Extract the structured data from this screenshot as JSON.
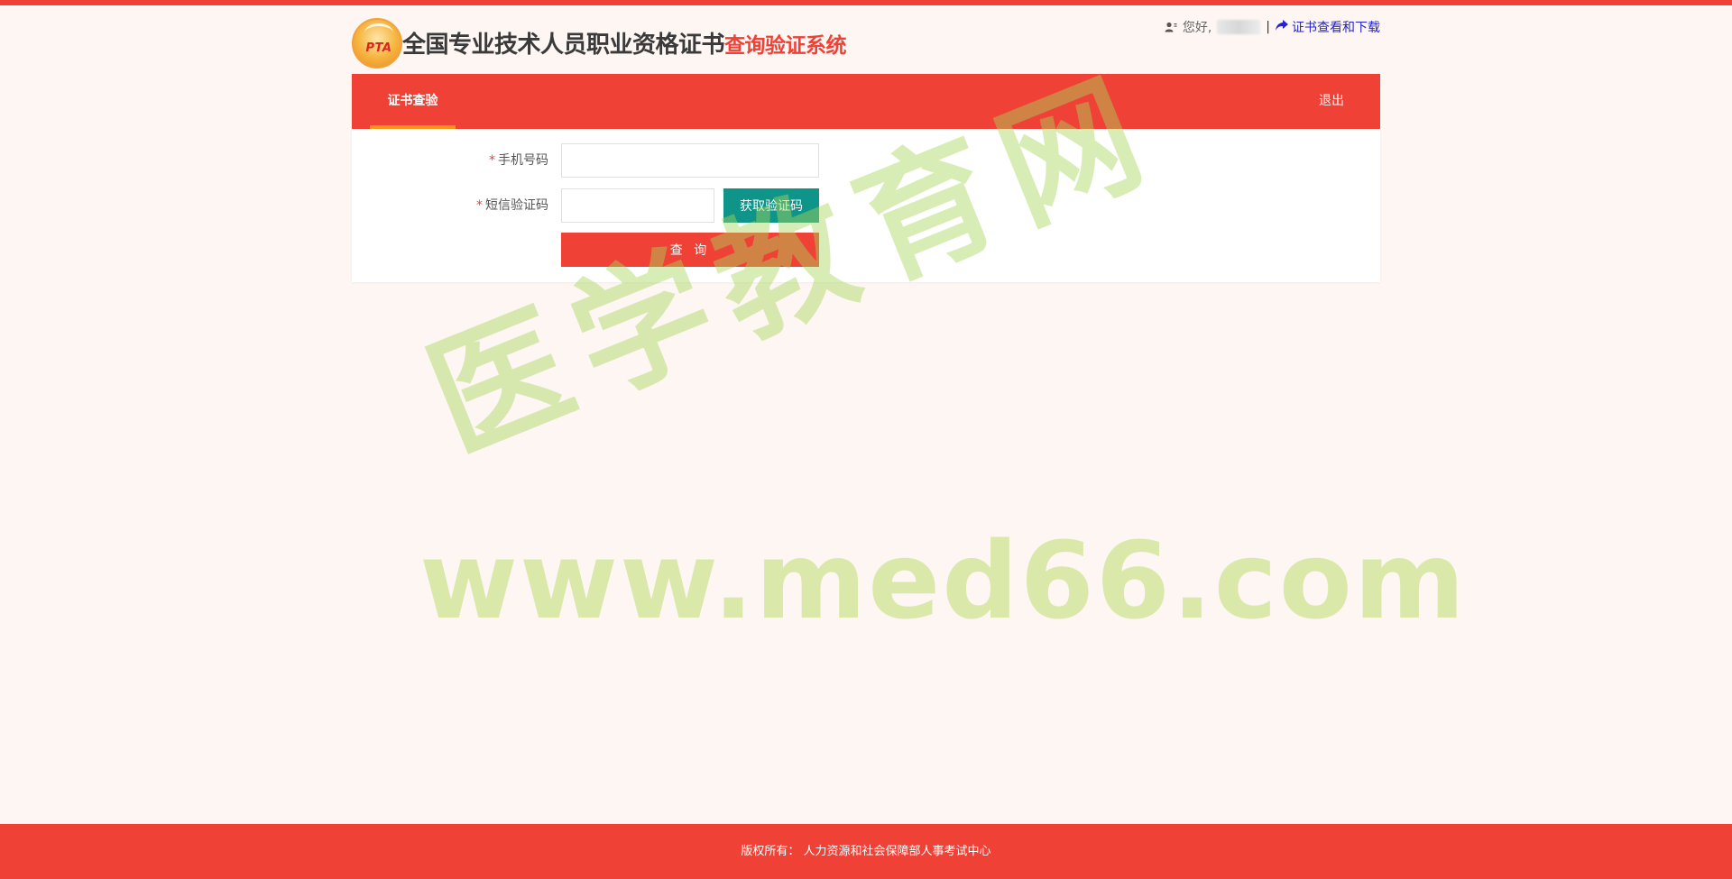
{
  "header": {
    "logo_text": "PTA",
    "title_main": "全国专业技术人员职业资格证书",
    "title_accent": "查询验证系统",
    "greeting": "您好,",
    "separator": "|",
    "cert_link": "证书查看和下载"
  },
  "nav": {
    "tab_label": "证书查验",
    "logout_label": "退出"
  },
  "form": {
    "phone_required": "*",
    "phone_label": "手机号码",
    "phone_value": "",
    "code_required": "*",
    "code_label": "短信验证码",
    "code_value": "",
    "get_code_label": "获取验证码",
    "query_label": "查 询"
  },
  "watermark": {
    "cn": "医学教育网",
    "url": "www.med66.com"
  },
  "footer": {
    "copyright": "版权所有： 人力资源和社会保障部人事考试中心"
  },
  "colors": {
    "brand": "#ef4136",
    "nav_indicator": "#f7931e",
    "code_button": "#0e9488",
    "link": "#2424cc"
  },
  "icons": {
    "user": "user-icon",
    "share": "share-arrow-icon"
  }
}
